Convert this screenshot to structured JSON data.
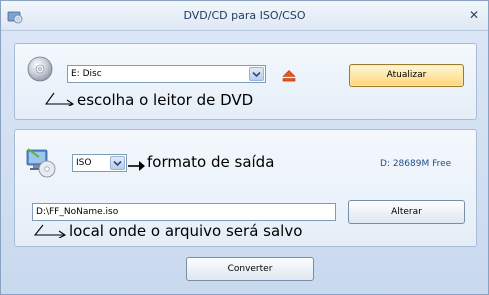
{
  "window": {
    "title": "DVD/CD para ISO/CSO",
    "close_glyph": "✕",
    "icon": "app-disc-icon"
  },
  "drive_section": {
    "icon": "cd-disc-icon",
    "drive_select": {
      "value": "E:  Disc"
    },
    "eject_icon": "eject-icon",
    "refresh_button": "Atualizar",
    "annotation": "escolha o leitor de DVD"
  },
  "output_section": {
    "icon": "computer-disc-icon",
    "format_select": {
      "value": "ISO"
    },
    "format_annotation": "formato de saída",
    "free_space": "D: 28689M Free",
    "path_input": {
      "value": "D:\\FF_NoName.iso"
    },
    "change_button": "Alterar",
    "path_annotation": "local onde o arquivo será salvo"
  },
  "convert_button": "Converter",
  "colors": {
    "accent": "#ffd57a",
    "free_text": "#1e4e86",
    "eject": "#e8541c"
  }
}
